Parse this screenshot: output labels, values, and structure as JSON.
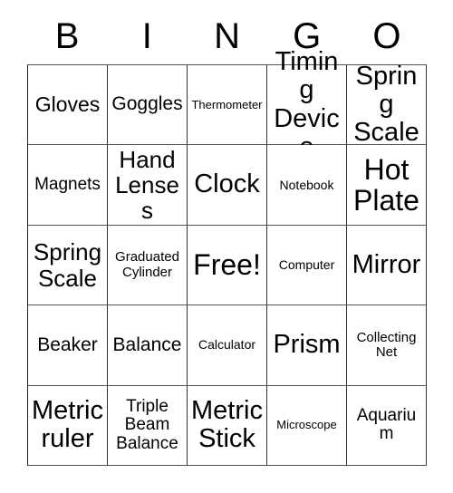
{
  "header": {
    "letters": [
      "B",
      "I",
      "N",
      "G",
      "O"
    ]
  },
  "grid": {
    "rows": [
      [
        {
          "label": "Gloves",
          "size": "fs-l"
        },
        {
          "label": "Goggles",
          "size": "fs-ml"
        },
        {
          "label": "Thermometer",
          "size": "fs-xs"
        },
        {
          "label": "Timing Device",
          "size": "fs-xxl"
        },
        {
          "label": "Spring Scale",
          "size": "fs-xxl"
        }
      ],
      [
        {
          "label": "Magnets",
          "size": "fs-m"
        },
        {
          "label": "Hand Lenses",
          "size": "fs-xl"
        },
        {
          "label": "Clock",
          "size": "fs-xxl"
        },
        {
          "label": "Notebook",
          "size": "fs-s"
        },
        {
          "label": "Hot Plate",
          "size": "fs-free"
        }
      ],
      [
        {
          "label": "Spring Scale",
          "size": "fs-xl"
        },
        {
          "label": "Graduated Cylinder",
          "size": "fs-sm"
        },
        {
          "label": "Free!",
          "size": "fs-free"
        },
        {
          "label": "Computer",
          "size": "fs-s"
        },
        {
          "label": "Mirror",
          "size": "fs-xxl"
        }
      ],
      [
        {
          "label": "Beaker",
          "size": "fs-ml"
        },
        {
          "label": "Balance",
          "size": "fs-ml"
        },
        {
          "label": "Calculator",
          "size": "fs-s"
        },
        {
          "label": "Prism",
          "size": "fs-xxl"
        },
        {
          "label": "Collecting Net",
          "size": "fs-sm"
        }
      ],
      [
        {
          "label": "Metric ruler",
          "size": "fs-xxl"
        },
        {
          "label": "Triple Beam Balance",
          "size": "fs-m"
        },
        {
          "label": "Metric Stick",
          "size": "fs-xxl"
        },
        {
          "label": "Microscope",
          "size": "fs-xs"
        },
        {
          "label": "Aquarium",
          "size": "fs-m"
        }
      ]
    ]
  },
  "colors": {
    "background": "#ffffff",
    "text": "#000000",
    "border": "#333333"
  }
}
